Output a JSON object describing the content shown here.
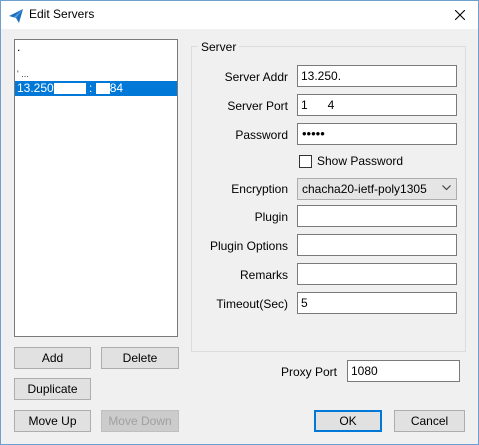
{
  "window": {
    "title": "Edit Servers"
  },
  "server_list": {
    "items": [
      {
        "text": "."
      },
      {
        "text": ""
      },
      {
        "text": "' ..."
      },
      {
        "text": "13.250",
        "port_fragment": "84"
      }
    ],
    "selected_index": 3
  },
  "buttons": {
    "add": "Add",
    "delete": "Delete",
    "duplicate": "Duplicate",
    "move_up": "Move Up",
    "move_down": "Move Down",
    "ok": "OK",
    "cancel": "Cancel"
  },
  "server_group": {
    "label": "Server",
    "fields": {
      "server_addr": {
        "label": "Server Addr",
        "value": "13.250."
      },
      "server_port": {
        "label": "Server Port",
        "value": "1      4"
      },
      "password": {
        "label": "Password",
        "value": "•••••"
      },
      "show_password": {
        "label": "Show Password",
        "checked": false
      },
      "encryption": {
        "label": "Encryption",
        "value": "chacha20-ietf-poly1305"
      },
      "plugin": {
        "label": "Plugin",
        "value": ""
      },
      "plugin_options": {
        "label": "Plugin Options",
        "value": ""
      },
      "remarks": {
        "label": "Remarks",
        "value": ""
      },
      "timeout": {
        "label": "Timeout(Sec)",
        "value": "5"
      }
    }
  },
  "proxy_port": {
    "label": "Proxy Port",
    "value": "1080"
  },
  "colors": {
    "selection": "#0078d7",
    "accent_border": "#0078d7"
  }
}
